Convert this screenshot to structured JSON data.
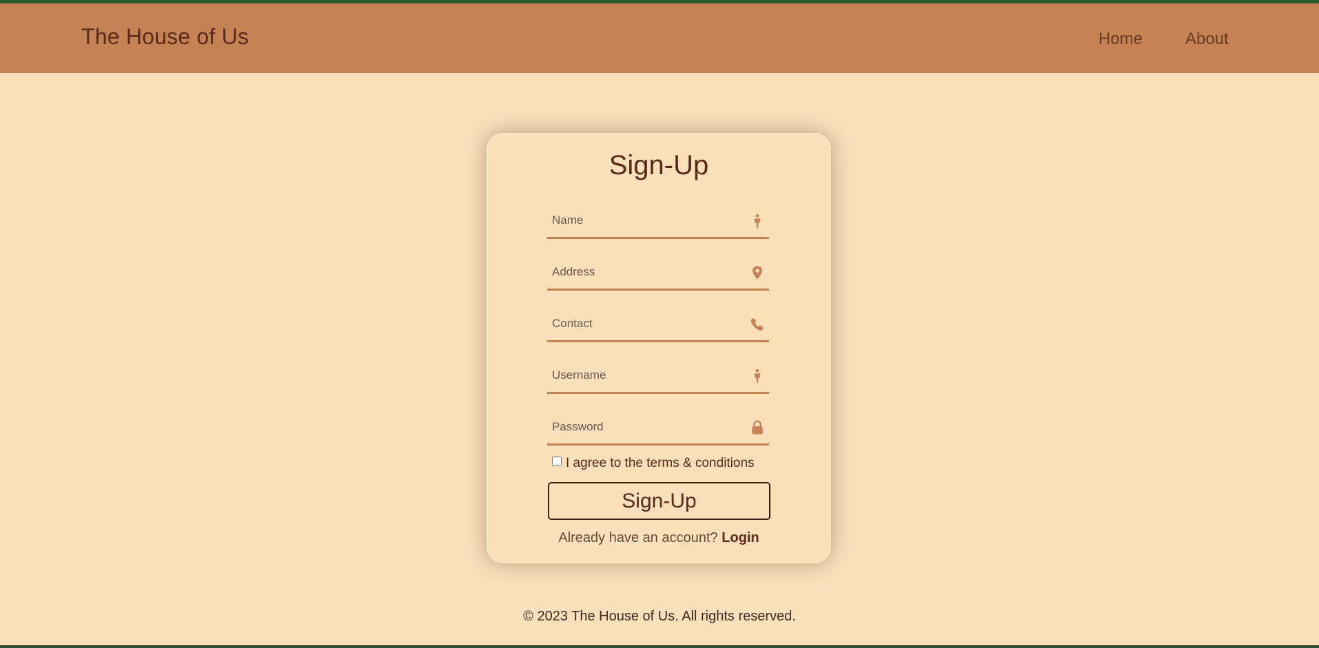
{
  "header": {
    "brand": "The House of Us",
    "nav": {
      "home": "Home",
      "about": "About"
    }
  },
  "form": {
    "title": "Sign-Up",
    "fields": {
      "name": {
        "placeholder": "Name",
        "value": "",
        "icon": "person-icon"
      },
      "address": {
        "placeholder": "Address",
        "value": "",
        "icon": "location-pin-icon"
      },
      "contact": {
        "placeholder": "Contact",
        "value": "",
        "icon": "phone-icon"
      },
      "username": {
        "placeholder": "Username",
        "value": "",
        "icon": "person-icon"
      },
      "password": {
        "placeholder": "Password",
        "value": "",
        "icon": "lock-icon"
      }
    },
    "terms_label": "I agree to the terms & conditions",
    "terms_checked": false,
    "submit_label": "Sign-Up",
    "login_prompt": "Already have an account?",
    "login_link": "Login"
  },
  "footer": {
    "text": "© 2023 The House of Us. All rights reserved."
  },
  "colors": {
    "background": "#f9dfba",
    "header": "#c48255",
    "accent_stripe": "#2d5a2c",
    "text_dark": "#5a2a1a",
    "field_underline": "#c48255"
  }
}
